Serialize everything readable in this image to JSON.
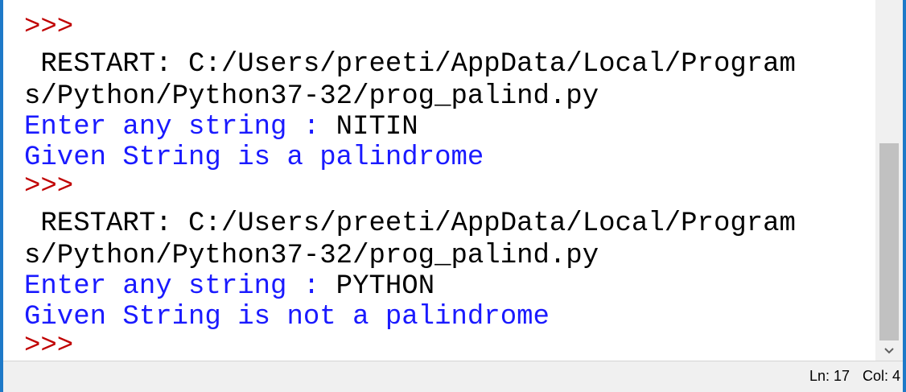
{
  "shell": {
    "lines": [
      {
        "type": "prompt",
        "text": ">>>"
      },
      {
        "type": "restart",
        "text": " RESTART: C:/Users/preeti/AppData/Local/Program"
      },
      {
        "type": "restart",
        "text": "s/Python/Python37-32/prog_palind.py"
      },
      {
        "type": "interaction",
        "prompt": "Enter any string : ",
        "input": "NITIN"
      },
      {
        "type": "output",
        "text": "Given String is a palindrome"
      },
      {
        "type": "prompt",
        "text": ">>>"
      },
      {
        "type": "restart",
        "text": " RESTART: C:/Users/preeti/AppData/Local/Program"
      },
      {
        "type": "restart",
        "text": "s/Python/Python37-32/prog_palind.py"
      },
      {
        "type": "interaction",
        "prompt": "Enter any string : ",
        "input": "PYTHON"
      },
      {
        "type": "output",
        "text": "Given String is not a palindrome"
      },
      {
        "type": "prompt",
        "text": ">>>"
      }
    ]
  },
  "statusbar": {
    "line": "Ln: 17",
    "col": "Col: 4"
  },
  "colors": {
    "prompt": "#c00000",
    "output": "#1a1aff",
    "text": "#000000",
    "window_border": "#1e79c8"
  },
  "icons": {
    "scroll_down": "chevron-down-icon"
  }
}
